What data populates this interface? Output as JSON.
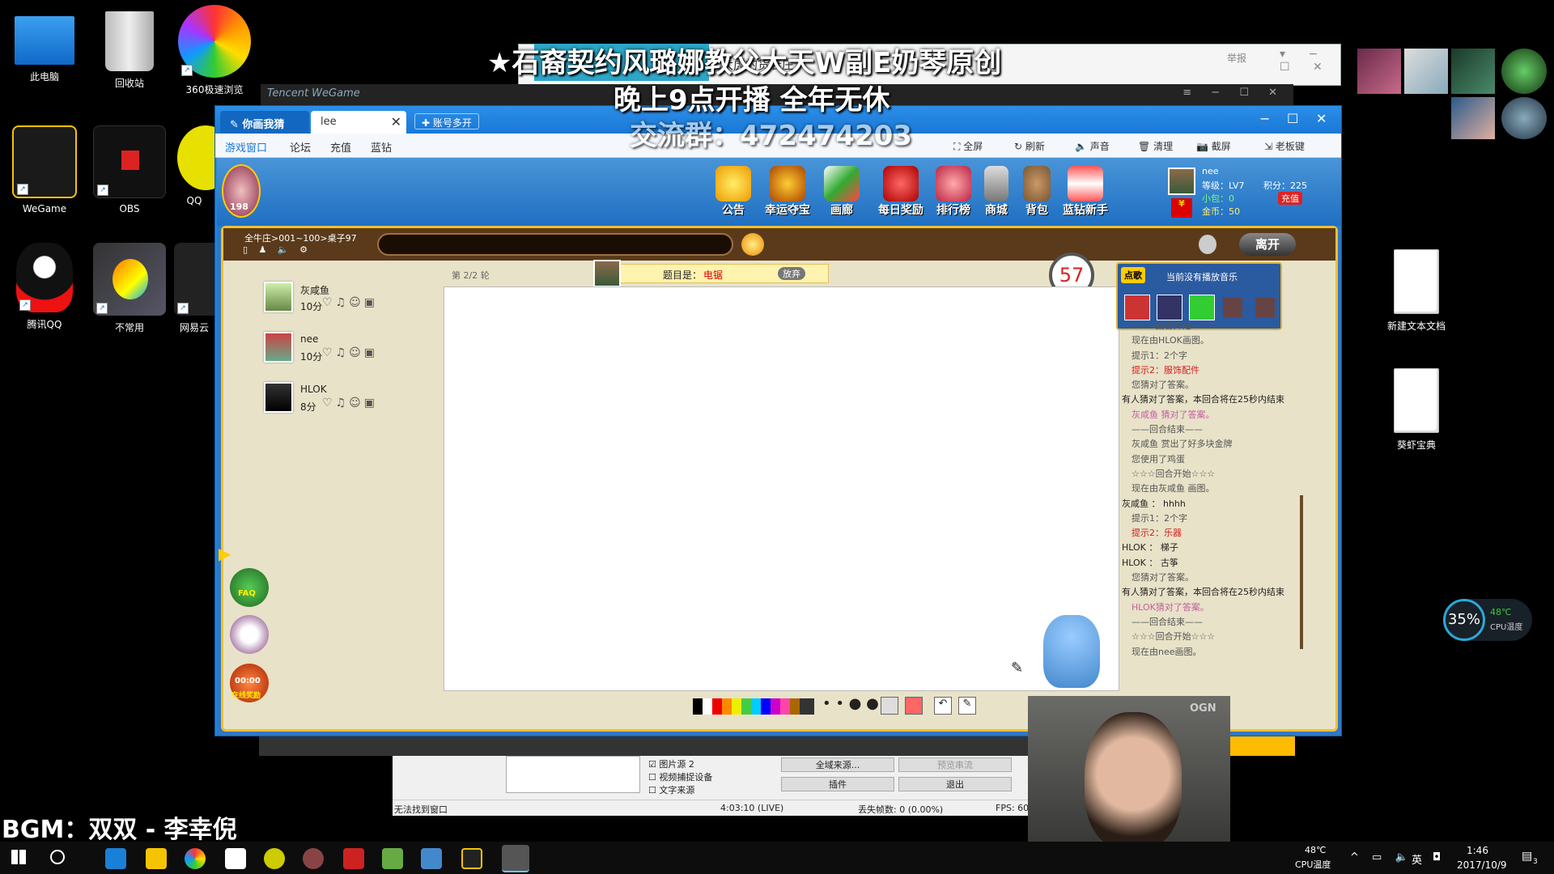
{
  "desktop": {
    "icons": [
      {
        "label": "此电脑",
        "icon": "computer-icon"
      },
      {
        "label": "回收站",
        "icon": "recycle-bin-icon"
      },
      {
        "label": "360极速浏览",
        "icon": "360-browser-icon"
      },
      {
        "label": "WeGame",
        "icon": "wegame-icon"
      },
      {
        "label": "OBS",
        "icon": "obs-icon"
      },
      {
        "label": "QQ",
        "icon": "qq-icon"
      },
      {
        "label": "腾讯QQ",
        "icon": "qq-penguin-icon"
      },
      {
        "label": "不常用",
        "icon": "folder-icon"
      },
      {
        "label": "网易云",
        "icon": "netease-icon"
      }
    ],
    "right_icons": [
      {
        "label": "新建文本文档"
      },
      {
        "label": "葵虾宝典"
      }
    ]
  },
  "overlay": {
    "line1": "★石裔契约风璐娜教父大天W副E奶琴原创",
    "line2": "晚上9点开播  全年无休",
    "line3": "交流群：472474203",
    "bgm": "BGM：双双 - 李幸倪",
    "behind_title": "大虎的货衰庄"
  },
  "wegame_title": "Tencent WeGame",
  "back_window": {
    "report": "举报"
  },
  "game": {
    "tab1": "你画我猜",
    "tab2": "lee",
    "tab3": "账号多开",
    "menu": [
      "游戏窗口",
      "论坛",
      "充值",
      "蓝钻"
    ],
    "tools": [
      "全屏",
      "刷新",
      "声音",
      "清理",
      "截屏",
      "老板键"
    ],
    "top_buttons": [
      "公告",
      "幸运夺宝",
      "画廊",
      "每日奖励",
      "排行榜",
      "商城",
      "背包",
      "蓝钻新手"
    ],
    "level_badge": "198",
    "user": {
      "name": "nee",
      "level": "等级：LV7",
      "score": "积分：225",
      "xiaomi": "小包：0",
      "coins": "金币：50",
      "recharge": "充值"
    },
    "breadcrumb": "全牛庄>001~100>桌子97",
    "leave": "离开",
    "round": "第 2/2 轮",
    "topic_label": "题目是：",
    "topic": "电锯",
    "giveup": "放弃",
    "timer": "57",
    "music_label": "点歌",
    "music_status": "当前没有播放音乐",
    "players": [
      {
        "name": "灰咸鱼",
        "score": "10分"
      },
      {
        "name": "nee",
        "score": "10分"
      },
      {
        "name": "HLOK",
        "score": "8分"
      }
    ],
    "chat": [
      {
        "t": "☆☆☆回合开始☆☆☆",
        "c": ""
      },
      {
        "t": "现在由HLOK画图。",
        "c": ""
      },
      {
        "t": "提示1：2个字",
        "c": ""
      },
      {
        "t": "提示2：服饰配件",
        "c": "r"
      },
      {
        "t": "您猜对了答案。",
        "c": ""
      },
      {
        "t": "有人猜对了答案，本回合将在25秒内结束",
        "c": "b"
      },
      {
        "t": "灰咸鱼 猜对了答案。",
        "c": "p"
      },
      {
        "t": "——回合结束——",
        "c": ""
      },
      {
        "t": "灰咸鱼 赏出了好多块金牌",
        "c": ""
      },
      {
        "t": "您使用了鸡蛋",
        "c": ""
      },
      {
        "t": "☆☆☆回合开始☆☆☆",
        "c": ""
      },
      {
        "t": "现在由灰咸鱼 画图。",
        "c": ""
      },
      {
        "t": "灰咸鱼 ： hhhh",
        "c": "b"
      },
      {
        "t": "提示1：2个字",
        "c": ""
      },
      {
        "t": "提示2：乐器",
        "c": "r"
      },
      {
        "t": "HLOK ： 梯子",
        "c": "b"
      },
      {
        "t": "HLOK ： 古筝",
        "c": "b"
      },
      {
        "t": "您猜对了答案。",
        "c": ""
      },
      {
        "t": "有人猜对了答案，本回合将在25秒内结束",
        "c": "b"
      },
      {
        "t": "HLOK猜对了答案。",
        "c": "p"
      },
      {
        "t": "——回合结束——",
        "c": ""
      },
      {
        "t": "☆☆☆回合开始☆☆☆",
        "c": ""
      },
      {
        "t": "现在由nee画图。",
        "c": ""
      }
    ],
    "side": {
      "faq": "FAQ",
      "online": "在线奖励",
      "time": "00:00"
    }
  },
  "obs": {
    "sources": [
      "图片源 2",
      "视频捕捉设备",
      "文字来源"
    ],
    "btn1": "全域来源...",
    "btn2": "预览串流",
    "btn3": "插件",
    "btn4": "退出",
    "status": "无法找到窗口",
    "time": "4:03:10 (LIVE)",
    "dropped": "丢失帧数: 0 (0.00%)",
    "fps": "FPS: 60"
  },
  "monitor": {
    "cpu": "35%",
    "temp": "48℃",
    "temp_label": "CPU温度"
  },
  "taskbar": {
    "temp": "48℃",
    "temp_label": "CPU温度",
    "time": "1:46",
    "date": "2017/10/9",
    "lang": "英",
    "notif": "3"
  }
}
